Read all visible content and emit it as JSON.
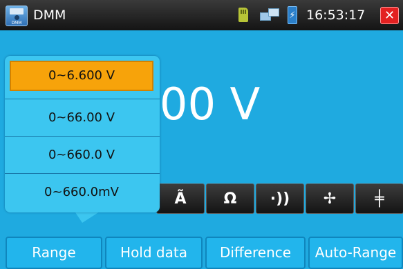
{
  "status_bar": {
    "app_icon_text": "DMM",
    "app_title": "DMM",
    "battery_symbol": "⚡",
    "time": "16:53:17",
    "close_symbol": "✕"
  },
  "reading": {
    "value_text": "000 V"
  },
  "function_bar": {
    "buttons": [
      {
        "symbol": "Ã",
        "icon": "ac-current-icon"
      },
      {
        "symbol": "Ω",
        "icon": "resistance-icon"
      },
      {
        "symbol": "·))",
        "icon": "continuity-icon"
      },
      {
        "symbol": "✢",
        "icon": "diode-icon"
      },
      {
        "symbol": "╪",
        "icon": "capacitance-icon"
      }
    ]
  },
  "range_popup": {
    "options": [
      {
        "label": "0~6.600 V",
        "selected": true
      },
      {
        "label": "0~66.00 V",
        "selected": false
      },
      {
        "label": "0~660.0 V",
        "selected": false
      },
      {
        "label": "0~660.0mV",
        "selected": false
      }
    ]
  },
  "bottom_bar": {
    "range_label": "Range",
    "hold_label": "Hold data",
    "difference_label": "Difference",
    "auto_range_label": "Auto-Range"
  },
  "colors": {
    "background": "#1faae0",
    "popup": "#3cc6f0",
    "selected_option": "#f7a30a",
    "close_button": "#e32121"
  }
}
